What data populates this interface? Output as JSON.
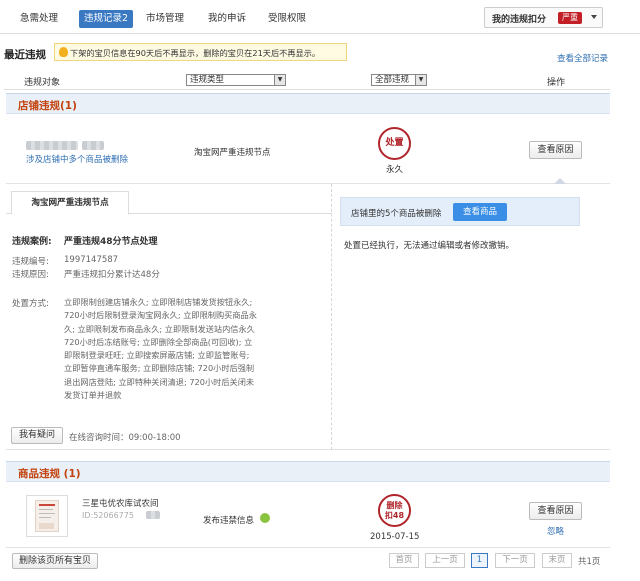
{
  "nav": {
    "tabs": [
      {
        "label": "急需处理"
      },
      {
        "label": "违规记录2"
      },
      {
        "label": "市场管理"
      },
      {
        "label": "我的申诉"
      },
      {
        "label": "受限权限"
      }
    ],
    "points_label": "我的违规扣分",
    "points_badge": "严重"
  },
  "header": {
    "title": "最近违规",
    "notice": "下架的宝贝信息在90天后不再显示，删除的宝贝在21天后不再显示。",
    "view_all": "查看全部记录"
  },
  "filters": {
    "col_object": "违规对象",
    "type_select": "违规类型",
    "all_select": "全部违规",
    "col_action": "操作"
  },
  "shop_section": {
    "title": "店铺违规(1)",
    "item": {
      "desc": "涉及店铺中多个商品被删除",
      "node": "淘宝网严重违规节点",
      "stamp": "处置",
      "duration": "永久",
      "reason_button": "查看原因"
    },
    "detail": {
      "tab": "淘宝网严重违规节点",
      "case_label": "违规案例:",
      "case_value": "严重违规48分节点处理",
      "id_label": "违规编号:",
      "id_value": "1997147587",
      "reason_label": "违规原因:",
      "reason_value": "严重违规扣分累计达48分",
      "method_label": "处置方式:",
      "method_lines": [
        "立即限制创建店铺永久; 立即限制店铺发货按钮永久;",
        "720小时后限制登录淘宝网永久; 立即限制购买商品永",
        "久; 立即限制发布商品永久; 立即限制发送站内信永久",
        "720小时后冻结账号; 立即删除全部商品(可回收); 立",
        "即限制登录旺旺; 立即搜索屏蔽店铺; 立即监管账号;",
        "立即暂停直通车服务; 立即删除店铺; 720小时后强制",
        "退出网店登陆; 立即特种关闭清退; 720小时后关闭未",
        "发货订单并退款"
      ],
      "question_button": "我有疑问",
      "consult_time": "在线咨询时间：09:00-18:00",
      "notice_text": "店铺里的5个商品被删除",
      "view_goods_button": "查看商品",
      "executed_text": "处置已经执行，无法通过编辑或者修改撤销。"
    }
  },
  "goods_section": {
    "title": "商品违规 (1)",
    "item": {
      "name": "三星屯优农库试农间",
      "id_prefix": "ID:52066775",
      "violation": "发布违禁信息",
      "stamp_top": "删除",
      "stamp_bottom": "扣48",
      "date": "2015-07-15",
      "reason_button": "查看原因",
      "ignore": "忽略"
    }
  },
  "footer": {
    "delete_all_button": "删除该页所有宝贝",
    "pager": {
      "first": "首页",
      "prev": "上一页",
      "current": "1",
      "next": "下一页",
      "last": "末页",
      "total": "共1页"
    }
  },
  "colors": {
    "accent": "#3a78c2",
    "danger": "#b0252b",
    "section_title": "#c2410c"
  }
}
